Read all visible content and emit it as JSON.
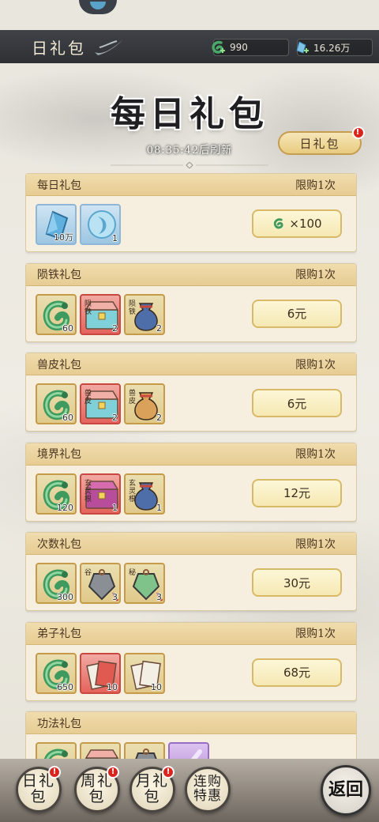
{
  "header": {
    "title": "日礼包",
    "currencies": [
      {
        "icon": "jade-coin-icon",
        "value": "990"
      },
      {
        "icon": "spirit-crystal-icon",
        "value": "16.26万"
      }
    ]
  },
  "main": {
    "title": "每日礼包",
    "refresh_text": "08:35:42后刷新",
    "active_tab": "日礼包"
  },
  "packs": [
    {
      "name": "每日礼包",
      "limit": "限购1次",
      "price": "×100",
      "price_icon": "jade-coin-icon",
      "items": [
        {
          "icon": "spirit-crystal-icon",
          "qty": "10万",
          "rarity": "blue"
        },
        {
          "icon": "moon-orb-icon",
          "qty": "1",
          "rarity": "blue"
        }
      ]
    },
    {
      "name": "陨铁礼包",
      "limit": "限购1次",
      "price": "6元",
      "items": [
        {
          "icon": "jade-coin-icon",
          "qty": "60",
          "rarity": "gold"
        },
        {
          "icon": "treasure-chest-icon",
          "qty": "2",
          "rarity": "red",
          "label": "陨铁"
        },
        {
          "icon": "pouch-icon",
          "qty": "2",
          "rarity": "gold",
          "label": "陨铁",
          "pouch": "blue"
        }
      ]
    },
    {
      "name": "兽皮礼包",
      "limit": "限购1次",
      "price": "6元",
      "items": [
        {
          "icon": "jade-coin-icon",
          "qty": "60",
          "rarity": "gold"
        },
        {
          "icon": "treasure-chest-icon",
          "qty": "2",
          "rarity": "red",
          "label": "兽皮"
        },
        {
          "icon": "pouch-icon",
          "qty": "2",
          "rarity": "gold",
          "label": "兽皮",
          "pouch": "tan"
        }
      ]
    },
    {
      "name": "境界礼包",
      "limit": "限购1次",
      "price": "12元",
      "items": [
        {
          "icon": "jade-coin-icon",
          "qty": "120",
          "rarity": "gold"
        },
        {
          "icon": "treasure-chest-icon",
          "qty": "1",
          "rarity": "red",
          "label": "玄灵根",
          "chest": "purple"
        },
        {
          "icon": "pouch-icon",
          "qty": "1",
          "rarity": "gold",
          "label": "玄灵根",
          "pouch": "blue"
        }
      ]
    },
    {
      "name": "次数礼包",
      "limit": "限购1次",
      "price": "30元",
      "items": [
        {
          "icon": "jade-coin-icon",
          "qty": "300",
          "rarity": "gold"
        },
        {
          "icon": "token-icon",
          "qty": "3",
          "rarity": "gold",
          "label": "谷"
        },
        {
          "icon": "token-icon",
          "qty": "3",
          "rarity": "gold",
          "label": "秘",
          "token": "green"
        }
      ]
    },
    {
      "name": "弟子礼包",
      "limit": "限购1次",
      "price": "68元",
      "items": [
        {
          "icon": "jade-coin-icon",
          "qty": "650",
          "rarity": "gold"
        },
        {
          "icon": "scroll-card-icon",
          "qty": "10",
          "rarity": "red"
        },
        {
          "icon": "scroll-card-icon",
          "qty": "10",
          "rarity": "gold",
          "card": "white"
        }
      ]
    },
    {
      "name": "功法礼包",
      "limit": "",
      "price": "",
      "items": [
        {
          "icon": "jade-coin-icon",
          "qty": "",
          "rarity": "gold"
        },
        {
          "icon": "treasure-chest-icon",
          "qty": "",
          "rarity": "gold"
        },
        {
          "icon": "token-icon",
          "qty": "",
          "rarity": "gold"
        },
        {
          "icon": "purple-scroll-icon",
          "qty": "",
          "rarity": "purple"
        }
      ]
    }
  ],
  "bottom_nav": [
    {
      "label": "日礼包",
      "badge": "!"
    },
    {
      "label": "周礼包",
      "badge": "!"
    },
    {
      "label": "月礼包",
      "badge": "!"
    },
    {
      "label": "连购特惠",
      "badge": ""
    }
  ],
  "return_label": "返回"
}
